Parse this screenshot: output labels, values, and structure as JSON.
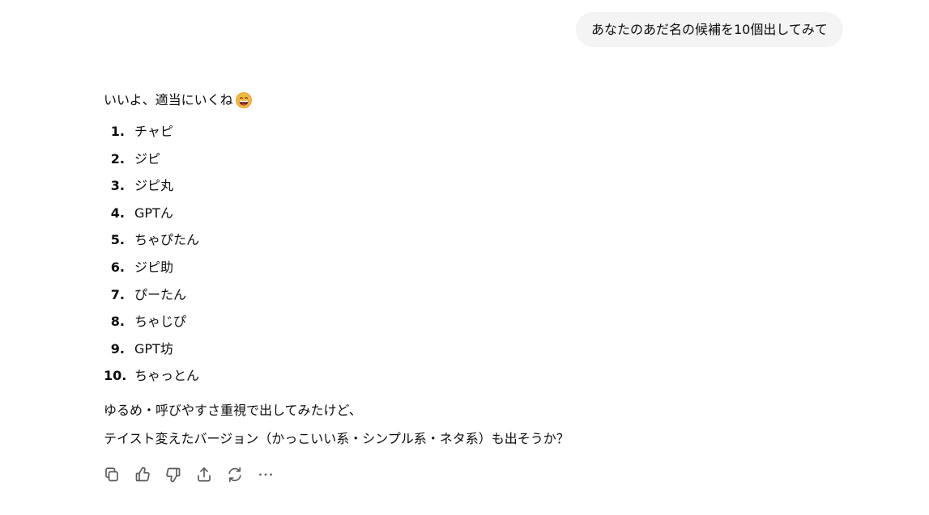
{
  "user_message": "あなたのあだ名の候補を10個出してみて",
  "assistant": {
    "intro": "いいよ、適当にいくね",
    "intro_emoji": "grinning-face-emoji",
    "items": [
      {
        "num": "1.",
        "text": "チャピ"
      },
      {
        "num": "2.",
        "text": "ジピ"
      },
      {
        "num": "3.",
        "text": "ジピ丸"
      },
      {
        "num": "4.",
        "text": "GPTん"
      },
      {
        "num": "5.",
        "text": "ちゃぴたん"
      },
      {
        "num": "6.",
        "text": "ジピ助"
      },
      {
        "num": "7.",
        "text": "ぴーたん"
      },
      {
        "num": "8.",
        "text": "ちゃじぴ"
      },
      {
        "num": "9.",
        "text": "GPT坊"
      },
      {
        "num": "10.",
        "text": "ちゃっとん"
      }
    ],
    "outro_line1": "ゆるめ・呼びやすさ重視で出してみたけど、",
    "outro_line2": "テイスト変えたバージョン（かっこいい系・シンプル系・ネタ系）も出そうか？"
  },
  "actions": [
    "copy-icon",
    "thumbs-up-icon",
    "thumbs-down-icon",
    "share-icon",
    "regenerate-icon",
    "more-icon"
  ],
  "colors": {
    "bubble_bg": "#f4f4f4",
    "text": "#0d0d0d",
    "icon": "#5d5d5d"
  }
}
